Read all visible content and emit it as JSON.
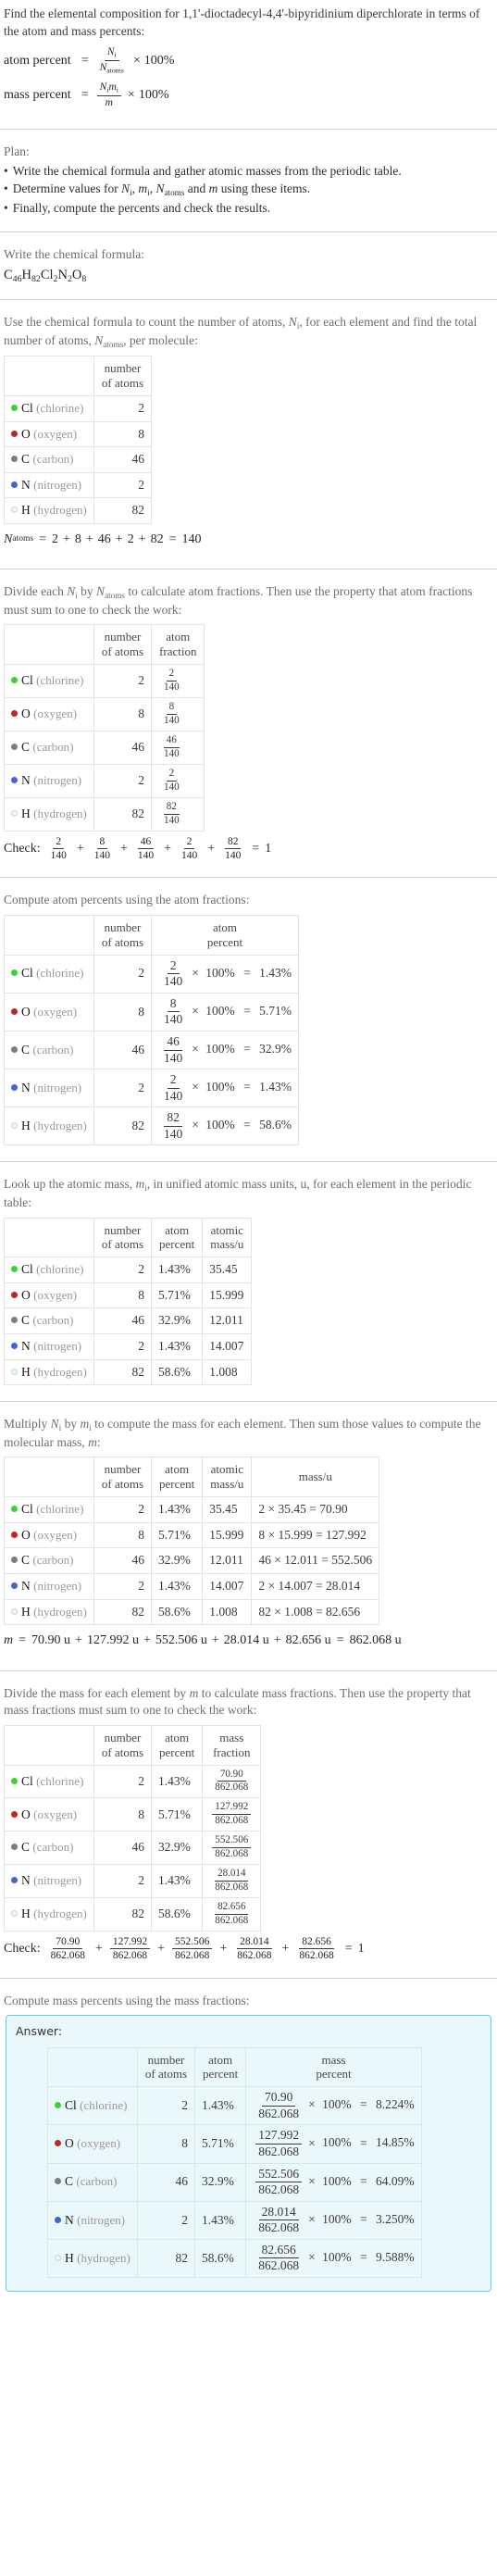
{
  "intro": {
    "question": "Find the elemental composition for 1,1'-dioctadecyl-4,4'-bipyridinium diperchlorate in terms of the atom and mass percents:",
    "atom_percent_label": "atom percent",
    "mass_percent_label": "mass percent",
    "percent_100": "100%"
  },
  "plan": {
    "title": "Plan:",
    "items": [
      "Write the chemical formula and gather atomic masses from the periodic table.",
      "Determine values for N_i, m_i, N_atoms and m using these items.",
      "Finally, compute the percents and check the results."
    ],
    "item1": "Write the chemical formula and gather atomic masses from the periodic table.",
    "item3": "Finally, compute the percents and check the results."
  },
  "formula_section": {
    "prompt": "Write the chemical formula:",
    "formula_parts": [
      {
        "sym": "C",
        "sub": "46"
      },
      {
        "sym": "H",
        "sub": "82"
      },
      {
        "sym": "Cl",
        "sub": "2"
      },
      {
        "sym": "N",
        "sub": "2"
      },
      {
        "sym": "O",
        "sub": "8"
      }
    ]
  },
  "counts_section": {
    "prompt": "Use the chemical formula to count the number of atoms, N_i, for each element and find the total number of atoms, N_atoms, per molecule:",
    "header_col0": "",
    "header_number_of_atoms": "number of atoms",
    "total_line": "N_atoms = 2 + 8 + 46 + 2 + 82 = 140",
    "total_terms": [
      "2",
      "8",
      "46",
      "2",
      "82"
    ],
    "total_value": "140"
  },
  "fraction_section": {
    "prompt": "Divide each N_i by N_atoms to calculate atom fractions. Then use the property that atom fractions must sum to one to check the work:",
    "header_atom_fraction": "atom fraction",
    "check_label": "Check:",
    "check_result": "1"
  },
  "atom_percent_section": {
    "prompt": "Compute atom percents using the atom fractions:",
    "header_atom_percent": "atom percent"
  },
  "atomic_mass_section": {
    "prompt": "Look up the atomic mass, m_i, in unified atomic mass units, u, for each element in the periodic table:",
    "header_atomic_mass": "atomic mass/u"
  },
  "mass_section": {
    "prompt": "Multiply N_i by m_i to compute the mass for each element. Then sum those values to compute the molecular mass, m:",
    "header_mass": "mass/u",
    "molecular_mass_line": "m = 70.90 u + 127.992 u + 552.506 u + 28.014 u + 82.656 u = 862.068 u",
    "molecular_mass_terms": [
      "70.90 u",
      "127.992 u",
      "552.506 u",
      "28.014 u",
      "82.656 u"
    ],
    "molecular_mass_total": "862.068 u"
  },
  "mass_fraction_section": {
    "prompt": "Divide the mass for each element by m to calculate mass fractions. Then use the property that mass fractions must sum to one to check the work:",
    "header_mass_fraction": "mass fraction",
    "check_label": "Check:",
    "check_result": "1"
  },
  "mass_percent_section": {
    "prompt": "Compute mass percents using the mass fractions:",
    "answer_label": "Answer:",
    "header_mass_percent": "mass percent"
  },
  "headers": {
    "number_of_atoms_l1": "number",
    "number_of_atoms_l2": "of atoms",
    "atom_l1": "atom",
    "fraction_l2": "fraction",
    "percent_l2": "percent",
    "atomic_l1": "atomic",
    "massu_l2": "mass/u",
    "massu": "mass/u",
    "mass_l1": "mass"
  },
  "total_atoms": "140",
  "molecular_mass": "862.068",
  "colors": {
    "chlorine": "#3fd130",
    "oxygen": "#c0271d",
    "carbon": "#7d7d7d",
    "nitrogen": "#4464d6",
    "hydrogen": "#ecf7fb",
    "accent_border": "#7fc4d8",
    "answer_bg": "#eaf7fb"
  },
  "elements": [
    {
      "symbol": "Cl",
      "name": "(chlorine)",
      "color": "#3fd130",
      "hollow": false,
      "count": "2",
      "atom_fraction_num": "2",
      "atom_fraction_den": "140",
      "atom_percent": "1.43%",
      "atomic_mass": "35.45",
      "mass_expr": "2 × 35.45 = 70.90",
      "mass_factor": "2",
      "mass_unit": "35.45",
      "mass_value": "70.90",
      "mass_fraction_num": "70.90",
      "mass_fraction_den": "862.068",
      "mass_percent": "8.224%"
    },
    {
      "symbol": "O",
      "name": "(oxygen)",
      "color": "#c0271d",
      "hollow": false,
      "count": "8",
      "atom_fraction_num": "8",
      "atom_fraction_den": "140",
      "atom_percent": "5.71%",
      "atomic_mass": "15.999",
      "mass_expr": "8 × 15.999 = 127.992",
      "mass_factor": "8",
      "mass_unit": "15.999",
      "mass_value": "127.992",
      "mass_fraction_num": "127.992",
      "mass_fraction_den": "862.068",
      "mass_percent": "14.85%"
    },
    {
      "symbol": "C",
      "name": "(carbon)",
      "color": "#7d7d7d",
      "hollow": false,
      "count": "46",
      "atom_fraction_num": "46",
      "atom_fraction_den": "140",
      "atom_percent": "32.9%",
      "atomic_mass": "12.011",
      "mass_expr": "46 × 12.011 = 552.506",
      "mass_factor": "46",
      "mass_unit": "12.011",
      "mass_value": "552.506",
      "mass_fraction_num": "552.506",
      "mass_fraction_den": "862.068",
      "mass_percent": "64.09%"
    },
    {
      "symbol": "N",
      "name": "(nitrogen)",
      "color": "#4464d6",
      "hollow": false,
      "count": "2",
      "atom_fraction_num": "2",
      "atom_fraction_den": "140",
      "atom_percent": "1.43%",
      "atomic_mass": "14.007",
      "mass_expr": "2 × 14.007 = 28.014",
      "mass_factor": "2",
      "mass_unit": "14.007",
      "mass_value": "28.014",
      "mass_fraction_num": "28.014",
      "mass_fraction_den": "862.068",
      "mass_percent": "3.250%"
    },
    {
      "symbol": "H",
      "name": "(hydrogen)",
      "color": "#ecf7fb",
      "hollow": true,
      "count": "82",
      "atom_fraction_num": "82",
      "atom_fraction_den": "140",
      "atom_percent": "58.6%",
      "atomic_mass": "1.008",
      "mass_expr": "82 × 1.008 = 82.656",
      "mass_factor": "82",
      "mass_unit": "1.008",
      "mass_value": "82.656",
      "mass_fraction_num": "82.656",
      "mass_fraction_den": "862.068",
      "mass_percent": "9.588%"
    }
  ]
}
